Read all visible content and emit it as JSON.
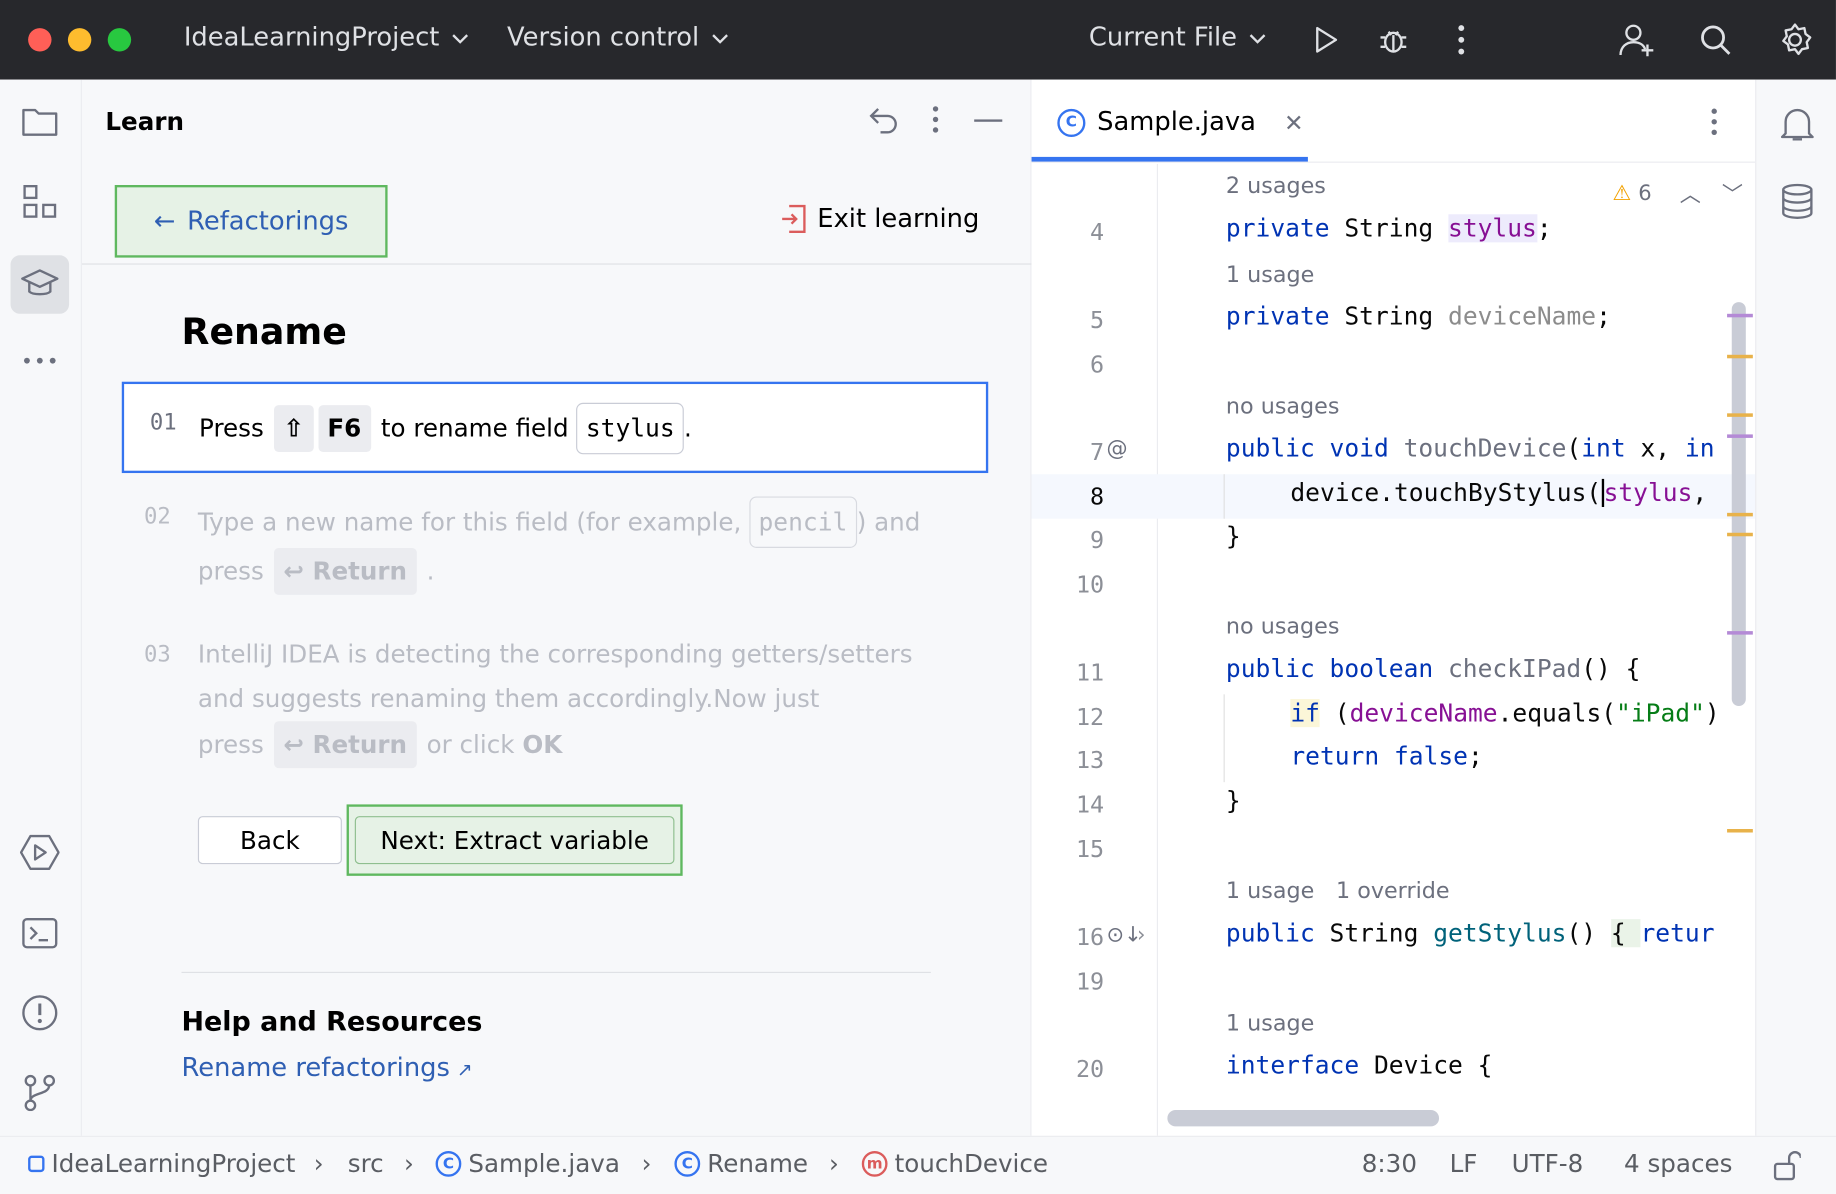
{
  "titlebar": {
    "project": "IdeaLearningProject",
    "vcs": "Version control",
    "run_config": "Current File"
  },
  "learn": {
    "title": "Learn",
    "back_label": "Refactorings",
    "exit_label": "Exit learning",
    "lesson_title": "Rename",
    "step1": {
      "num": "01",
      "press": "Press",
      "key_shift": "⇧",
      "key_f6": "F6",
      "text": "to rename field",
      "code": "stylus",
      "end": "."
    },
    "step2": {
      "num": "02",
      "text_a": "Type a new name for this field (for example,",
      "code": "pencil",
      "text_b": ") and",
      "press": "press",
      "key": "↩ Return",
      "end": "."
    },
    "step3": {
      "num": "03",
      "line1": "IntelliJ IDEA is detecting the corresponding getters/setters",
      "line2": "and suggests renaming them accordingly.Now just",
      "press": "press",
      "key": "↩ Return",
      "or_click": "or click",
      "ok": "OK"
    },
    "back_button": "Back",
    "next_button": "Next: Extract variable",
    "help_title": "Help and Resources",
    "help_link": "Rename refactorings",
    "help_link_arrow": "↗"
  },
  "editor": {
    "tab_label": "Sample.java",
    "tab_icon_letter": "C",
    "warnings_count": "6",
    "line_numbers": [
      "4",
      "5",
      "6",
      "7",
      "8",
      "9",
      "10",
      "11",
      "12",
      "13",
      "14",
      "15",
      "16",
      "19",
      "20"
    ],
    "hints": {
      "h1": "2 usages",
      "h2": "1 usage",
      "h3": "no usages",
      "h4": "no usages",
      "h5a": "1 usage",
      "h5b": "1 override",
      "h6": "1 usage"
    },
    "code": {
      "l4_kw": "private",
      "l4_type": " String ",
      "l4_fld": "stylus",
      "l4_end": ";",
      "l5_kw": "private",
      "l5_type": " String ",
      "l5_fld": "deviceName",
      "l5_end": ";",
      "l7_kw1": "public",
      "l7_kw2": " void ",
      "l7_name": "touchDevice",
      "l7_p1": "(",
      "l7_kw3": "int",
      "l7_p2": " x, ",
      "l7_kw4": "in",
      "l8_a": "device.touchByStylus(",
      "l8_fld": "stylus",
      "l8_end": ",",
      "l9": "}",
      "l11_kw1": "public",
      "l11_kw2": " boolean ",
      "l11_name": "checkIPad",
      "l11_end": "() {",
      "l12_kw": "if",
      "l12_p": " (",
      "l12_fld": "deviceName",
      "l12_m": ".equals(",
      "l12_str": "\"iPad\"",
      "l12_end": ")",
      "l13_kw1": "return",
      "l13_kw2": " false",
      "l13_end": ";",
      "l14": "}",
      "l16_kw": "public",
      "l16_type": " String ",
      "l16_name": "getStylus",
      "l16_p": "() ",
      "l16_brace": "{ ",
      "l16_kw2": "retur",
      "l20_kw": "interface",
      "l20_rest": " Device {"
    }
  },
  "status": {
    "project": "IdeaLearningProject",
    "src": "src",
    "file": "Sample.java",
    "class": "Rename",
    "method": "touchDevice",
    "method_icon": "m",
    "class_icon": "C",
    "position": "8:30",
    "line_sep": "LF",
    "encoding": "UTF-8",
    "indent": "4 spaces"
  },
  "icons": [
    "folder-icon",
    "structure-icon",
    "learn-icon",
    "more-icon",
    "run-icon",
    "terminal-icon",
    "problems-icon",
    "git-icon",
    "bell-icon",
    "database-icon",
    "run-button-icon",
    "debug-icon",
    "kebab-icon",
    "add-user-icon",
    "search-icon",
    "settings-icon"
  ],
  "colors": {
    "accent": "#3574f0",
    "titlebar_bg": "#27282c",
    "green_highlight": "#5fb85f"
  }
}
